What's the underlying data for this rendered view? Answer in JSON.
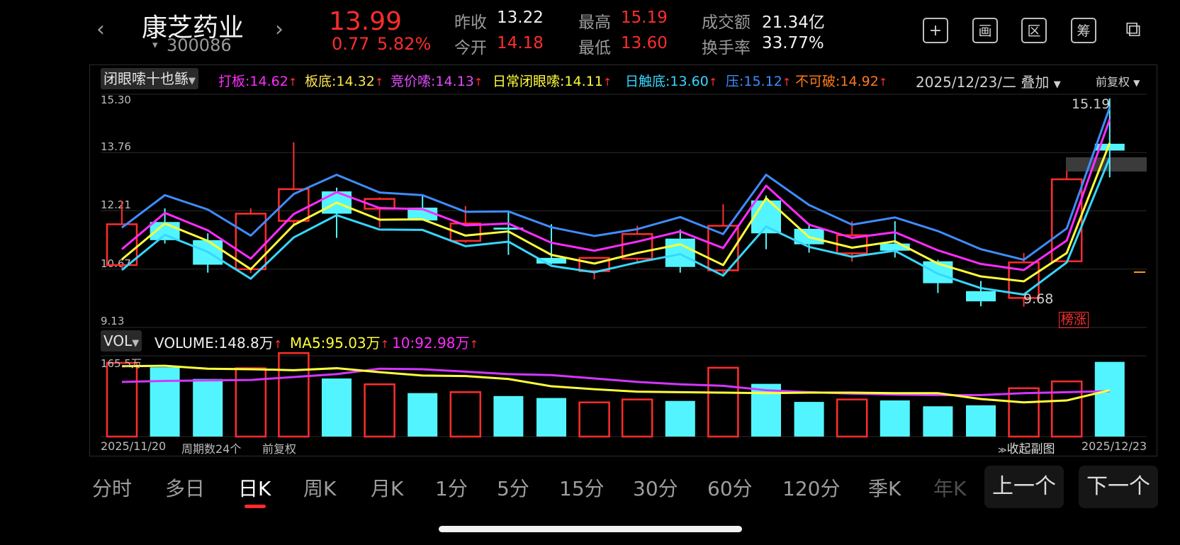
{
  "header": {
    "prev_arrow": "‹",
    "next_arrow": "›",
    "stock_name": "康芝药业",
    "stock_code_prefix": "▾",
    "stock_code": "300086",
    "price": "13.99",
    "change": "0.77",
    "change_pct": "5.82%",
    "stats": [
      {
        "label": "昨收",
        "value": "13.22",
        "color": "white"
      },
      {
        "label": "今开",
        "value": "14.18",
        "color": "red"
      },
      {
        "label": "最高",
        "value": "15.19",
        "color": "red"
      },
      {
        "label": "最低",
        "value": "13.60",
        "color": "red"
      },
      {
        "label": "成交额",
        "value": "21.34亿",
        "color": "white"
      },
      {
        "label": "换手率",
        "value": "33.77%",
        "color": "white"
      }
    ],
    "tool_icons": [
      "plus-icon",
      "draw-icon",
      "range-icon",
      "chip-icon",
      "split-screen-icon"
    ],
    "tool_glyphs": [
      "+",
      "画",
      "区",
      "筹",
      "⧉"
    ]
  },
  "indicator_bar": {
    "selector": "闭眼嗦十也鲧",
    "items": [
      {
        "text": "打板:14.62",
        "color": "#ff2cff"
      },
      {
        "text": "板底:14.32",
        "color": "#ffe54d"
      },
      {
        "text": "竞价嗦:14.13",
        "color": "#e34cff"
      },
      {
        "text": "日常闭眼嗦:14.11",
        "color": "#ffff3a"
      },
      {
        "text": "日触底:13.60",
        "color": "#36d7ff"
      },
      {
        "text": "压:15.12",
        "color": "#3f8cff"
      },
      {
        "text": "不可破:14.92",
        "color": "#ff7a1a"
      }
    ],
    "arrow": "↑",
    "date_overlay": "2025/12/23/二 叠加",
    "adjust": "前复权"
  },
  "price_axis": [
    "15.30",
    "13.76",
    "12.21",
    "10.67",
    "9.13"
  ],
  "high_label": "15.19",
  "low_label": "9.68",
  "badge": "榜涨",
  "volume_bar": {
    "selector": "VOL",
    "volume": "VOLUME:148.8万",
    "ma5": "MA5:95.03万",
    "ma10": "10:92.98万",
    "arrow": "↑",
    "axis_top": "165.5万"
  },
  "footer": {
    "start_date": "2025/11/20",
    "period_count": "周期数24个",
    "adjust": "前复权",
    "collapse": "收起副图",
    "end_date": "2025/12/23"
  },
  "tabs": [
    "分时",
    "多日",
    "日K",
    "周K",
    "月K",
    "1分",
    "5分",
    "15分",
    "30分",
    "60分",
    "120分",
    "季K",
    "年K"
  ],
  "active_tab": "日K",
  "nav_prev": "上一个",
  "nav_next": "下一个",
  "chart_data": {
    "type": "candlestick",
    "ylim": [
      9.13,
      15.3
    ],
    "candles": [
      {
        "o": 10.78,
        "h": 12.48,
        "l": 10.7,
        "c": 11.86,
        "up": true
      },
      {
        "o": 11.92,
        "h": 12.28,
        "l": 11.35,
        "c": 11.44,
        "up": false
      },
      {
        "o": 11.44,
        "h": 11.62,
        "l": 10.58,
        "c": 10.79,
        "up": false
      },
      {
        "o": 10.67,
        "h": 12.28,
        "l": 10.57,
        "c": 12.14,
        "up": true
      },
      {
        "o": 11.95,
        "h": 14.03,
        "l": 11.85,
        "c": 12.79,
        "up": true
      },
      {
        "o": 12.73,
        "h": 12.83,
        "l": 11.5,
        "c": 12.14,
        "up": false
      },
      {
        "o": 12.53,
        "h": 12.57,
        "l": 11.77,
        "c": 12.27,
        "up": true
      },
      {
        "o": 12.3,
        "h": 12.64,
        "l": 11.96,
        "c": 11.96,
        "up": false
      },
      {
        "o": 11.42,
        "h": 12.34,
        "l": 11.37,
        "c": 11.88,
        "up": true
      },
      {
        "o": 11.77,
        "h": 12.2,
        "l": 11.05,
        "c": 11.72,
        "up": false
      },
      {
        "o": 10.97,
        "h": 11.86,
        "l": 10.8,
        "c": 10.82,
        "up": false
      },
      {
        "o": 10.62,
        "h": 10.97,
        "l": 10.4,
        "c": 10.97,
        "up": true
      },
      {
        "o": 10.95,
        "h": 11.82,
        "l": 10.88,
        "c": 11.6,
        "up": true
      },
      {
        "o": 11.48,
        "h": 11.72,
        "l": 10.58,
        "c": 10.73,
        "up": false
      },
      {
        "o": 10.64,
        "h": 12.39,
        "l": 10.55,
        "c": 11.82,
        "up": true
      },
      {
        "o": 12.49,
        "h": 12.62,
        "l": 11.2,
        "c": 11.62,
        "up": false
      },
      {
        "o": 11.74,
        "h": 11.88,
        "l": 11.11,
        "c": 11.33,
        "up": false
      },
      {
        "o": 11.09,
        "h": 11.94,
        "l": 10.87,
        "c": 11.57,
        "up": true
      },
      {
        "o": 11.35,
        "h": 11.94,
        "l": 10.98,
        "c": 11.16,
        "up": false
      },
      {
        "o": 10.88,
        "h": 10.92,
        "l": 10.04,
        "c": 10.3,
        "up": false
      },
      {
        "o": 10.09,
        "h": 10.36,
        "l": 9.69,
        "c": 9.82,
        "up": false
      },
      {
        "o": 9.91,
        "h": 11.1,
        "l": 9.68,
        "c": 10.85,
        "up": true
      },
      {
        "o": 10.88,
        "h": 13.27,
        "l": 10.88,
        "c": 13.05,
        "up": true
      },
      {
        "o": 13.99,
        "h": 15.19,
        "l": 13.1,
        "c": 13.81,
        "up": false
      }
    ],
    "series": [
      {
        "name": "压",
        "color": "#3f8cff",
        "values": [
          11.77,
          12.63,
          12.25,
          11.56,
          12.66,
          13.17,
          12.7,
          12.63,
          12.19,
          12.2,
          11.78,
          11.55,
          11.73,
          12.05,
          11.6,
          13.17,
          12.37,
          11.85,
          12.04,
          11.68,
          11.2,
          10.92,
          11.75,
          14.95
        ]
      },
      {
        "name": "打板",
        "color": "#ff2cff",
        "values": [
          11.2,
          12.16,
          11.7,
          10.95,
          12.13,
          12.71,
          12.29,
          12.26,
          11.83,
          11.88,
          11.37,
          11.16,
          11.4,
          11.67,
          11.23,
          12.88,
          11.85,
          11.5,
          11.65,
          11.17,
          10.81,
          10.65,
          11.43,
          14.64
        ]
      },
      {
        "name": "日常闭眼嗦",
        "color": "#ffff3a",
        "values": [
          10.93,
          11.88,
          11.42,
          10.67,
          11.84,
          12.43,
          11.98,
          11.99,
          11.56,
          11.67,
          11.05,
          10.82,
          11.1,
          11.33,
          10.78,
          12.55,
          11.52,
          11.24,
          11.41,
          10.82,
          10.48,
          10.35,
          11.1,
          14.01
        ]
      },
      {
        "name": "日触底",
        "color": "#36d7ff",
        "values": [
          10.65,
          11.58,
          11.13,
          10.42,
          11.51,
          12.1,
          11.72,
          11.71,
          11.28,
          11.4,
          10.76,
          10.59,
          10.85,
          11.07,
          10.5,
          11.8,
          11.26,
          11.0,
          11.16,
          10.55,
          10.17,
          10.0,
          10.85,
          13.62
        ]
      }
    ],
    "volume": {
      "max": 165.5,
      "bars": [
        151,
        142,
        118,
        140,
        171,
        119,
        107,
        89,
        91,
        83,
        79,
        70,
        76,
        73,
        141,
        108,
        71,
        76,
        74,
        62,
        64,
        99,
        113,
        153
      ],
      "ma5": [
        144,
        145,
        139,
        138,
        136,
        140,
        132,
        125,
        124,
        118,
        103,
        97,
        92,
        91,
        90,
        89,
        90,
        90,
        89,
        89,
        77,
        70,
        74,
        95
      ],
      "ma10": [
        112,
        114,
        115,
        116,
        122,
        128,
        139,
        138,
        133,
        128,
        126,
        119,
        112,
        107,
        104,
        95,
        91,
        88,
        86,
        85,
        85,
        89,
        91,
        93
      ]
    }
  }
}
